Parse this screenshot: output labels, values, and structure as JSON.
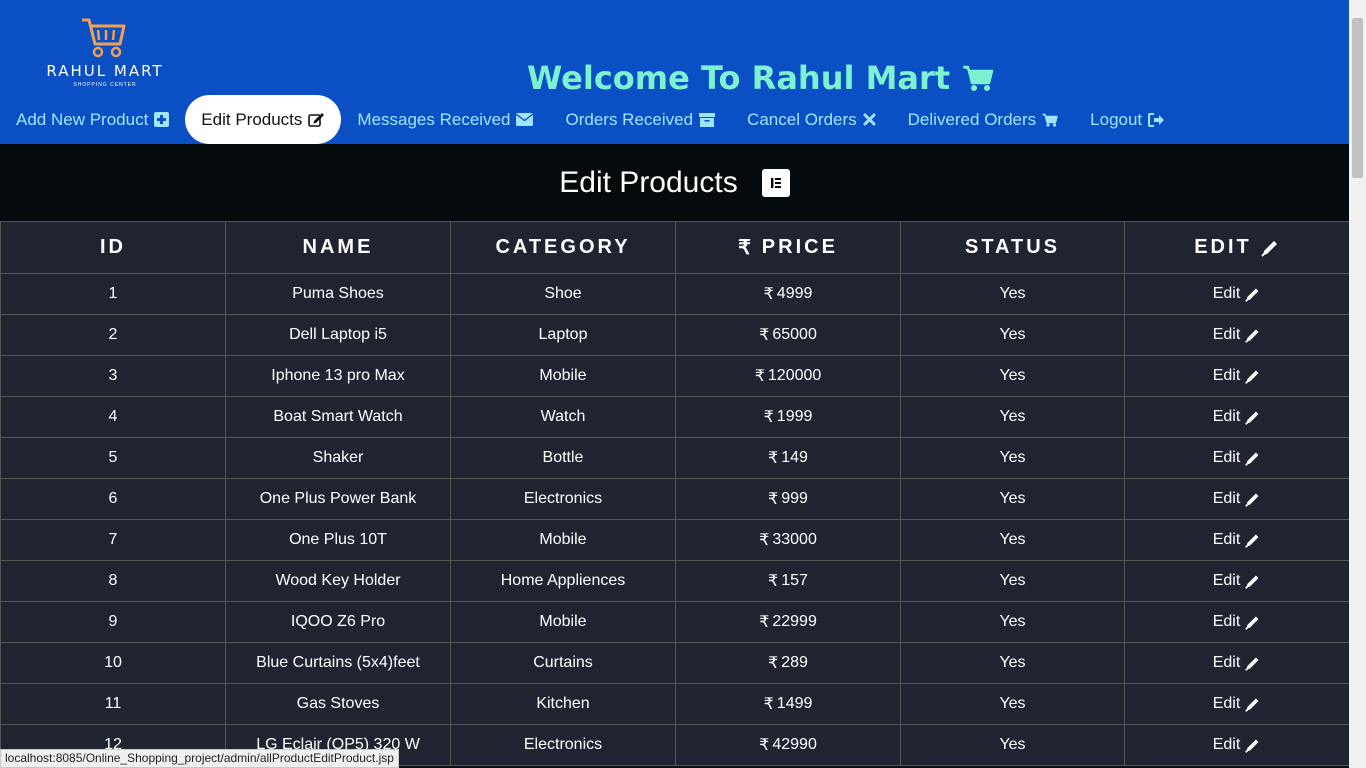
{
  "brand": {
    "name": "RAHUL MART",
    "tagline": "SHOPPING CENTER"
  },
  "header": {
    "welcome": "Welcome To Rahul Mart"
  },
  "nav": {
    "items": [
      {
        "label": "Add New Product",
        "icon": "plus-square-icon"
      },
      {
        "label": "Edit Products",
        "icon": "edit-icon",
        "active": true
      },
      {
        "label": "Messages Received",
        "icon": "envelope-icon"
      },
      {
        "label": "Orders Received",
        "icon": "archive-icon"
      },
      {
        "label": "Cancel Orders",
        "icon": "close-icon"
      },
      {
        "label": "Delivered Orders",
        "icon": "cart-icon"
      },
      {
        "label": "Logout",
        "icon": "logout-icon"
      }
    ]
  },
  "page": {
    "title": "Edit Products"
  },
  "table": {
    "columns": [
      "ID",
      "NAME",
      "CATEGORY",
      "PRICE",
      "STATUS",
      "EDIT"
    ],
    "currency": "₹",
    "edit_label": "Edit",
    "rows": [
      {
        "id": "1",
        "name": "Puma Shoes",
        "category": "Shoe",
        "price": "4999",
        "status": "Yes"
      },
      {
        "id": "2",
        "name": "Dell Laptop i5",
        "category": "Laptop",
        "price": "65000",
        "status": "Yes"
      },
      {
        "id": "3",
        "name": "Iphone 13 pro Max",
        "category": "Mobile",
        "price": "120000",
        "status": "Yes"
      },
      {
        "id": "4",
        "name": "Boat Smart Watch",
        "category": "Watch",
        "price": "1999",
        "status": "Yes"
      },
      {
        "id": "5",
        "name": "Shaker",
        "category": "Bottle",
        "price": "149",
        "status": "Yes"
      },
      {
        "id": "6",
        "name": "One Plus Power Bank",
        "category": "Electronics",
        "price": "999",
        "status": "Yes"
      },
      {
        "id": "7",
        "name": "One Plus 10T",
        "category": "Mobile",
        "price": "33000",
        "status": "Yes"
      },
      {
        "id": "8",
        "name": "Wood Key Holder",
        "category": "Home Appliences",
        "price": "157",
        "status": "Yes"
      },
      {
        "id": "9",
        "name": "IQOO Z6 Pro",
        "category": "Mobile",
        "price": "22999",
        "status": "Yes"
      },
      {
        "id": "10",
        "name": "Blue Curtains (5x4)feet",
        "category": "Curtains",
        "price": "289",
        "status": "Yes"
      },
      {
        "id": "11",
        "name": "Gas Stoves",
        "category": "Kitchen",
        "price": "1499",
        "status": "Yes"
      },
      {
        "id": "12",
        "name": "LG Eclair (OP5) 320 W",
        "category": "Electronics",
        "price": "42990",
        "status": "Yes"
      }
    ]
  },
  "status_bar": {
    "url": "localhost:8085/Online_Shopping_project/admin/allProductEditProduct.jsp"
  },
  "colors": {
    "header": "#0a4fc4",
    "welcome": "#7cf2d2",
    "nav_link": "#9fe5ff",
    "table_bg": "#1f2430"
  }
}
